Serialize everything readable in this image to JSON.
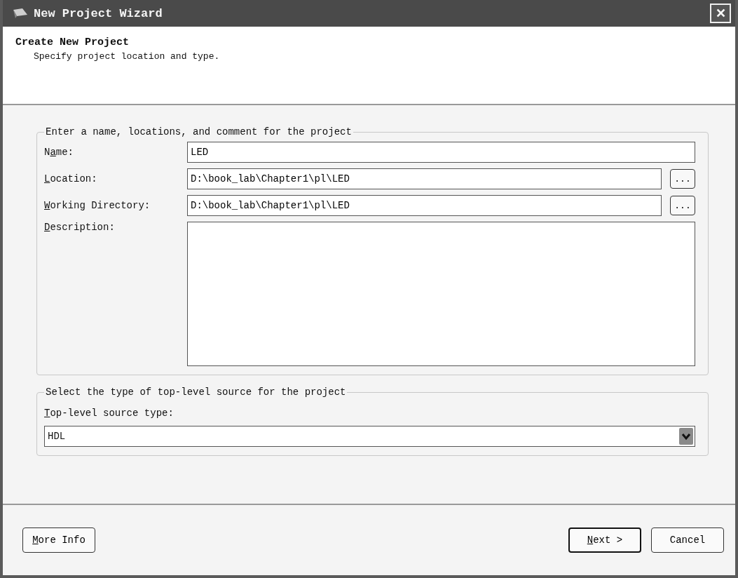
{
  "window": {
    "title": "New Project Wizard",
    "close": "✕"
  },
  "header": {
    "title": "Create New Project",
    "subtitle": "Specify project location and type."
  },
  "project_group": {
    "legend": "Enter a name, locations, and comment for the project",
    "fields": [
      {
        "kind": "text",
        "before": "N",
        "accel": "a",
        "after": "me:",
        "value": "LED"
      },
      {
        "kind": "browse",
        "accel": "L",
        "after": "ocation:",
        "value": "D:\\book_lab\\Chapter1\\pl\\LED",
        "button": "..."
      },
      {
        "kind": "browse",
        "accel": "W",
        "after": "orking Directory:",
        "value": "D:\\book_lab\\Chapter1\\pl\\LED",
        "button": "..."
      },
      {
        "kind": "area",
        "accel": "D",
        "after": "escription:"
      }
    ]
  },
  "source_group": {
    "legend": "Select the type of top-level source for the project",
    "accel": "T",
    "after": "op-level source type:",
    "value": "HDL"
  },
  "buttons": [
    {
      "kind": "left",
      "accel": "M",
      "after": "ore Info",
      "default": false
    },
    {
      "kind": "right",
      "accel": "N",
      "after": "ext >",
      "default": true
    },
    {
      "kind": "right",
      "label": "Cancel",
      "default": false
    }
  ]
}
